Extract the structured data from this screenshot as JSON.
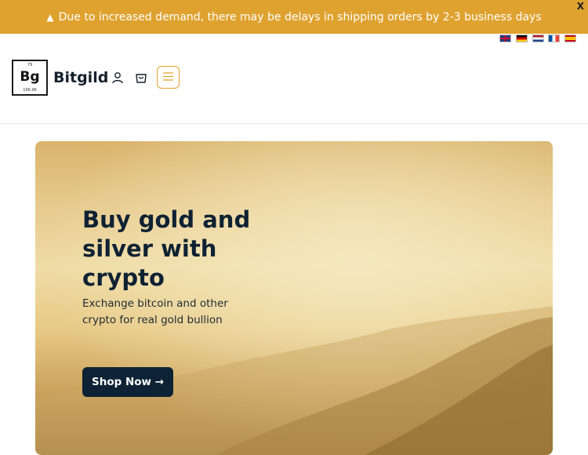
{
  "notice": {
    "icon": "warning-icon",
    "text": "Due to increased demand, there may be delays in shipping orders by 2-3 business days",
    "close_label": "X"
  },
  "languages": [
    {
      "name": "English",
      "icon": "flag-gb-icon"
    },
    {
      "name": "Deutsch",
      "icon": "flag-de-icon"
    },
    {
      "name": "Nederlands",
      "icon": "flag-nl-icon"
    },
    {
      "name": "Français",
      "icon": "flag-fr-icon"
    },
    {
      "name": "Español",
      "icon": "flag-es-icon"
    }
  ],
  "header": {
    "logo": {
      "number": "79",
      "symbol": "Bg",
      "mass": "196.96"
    },
    "brand": "Bitgild",
    "icons": [
      "user-icon",
      "cart-icon",
      "menu-icon"
    ]
  },
  "hero": {
    "title": "Buy gold and silver with crypto",
    "subtitle": "Exchange bitcoin and other crypto for real gold bullion",
    "cta": "Shop Now →"
  },
  "colors": {
    "accent": "#dfa22f",
    "dark": "#0d2235"
  }
}
